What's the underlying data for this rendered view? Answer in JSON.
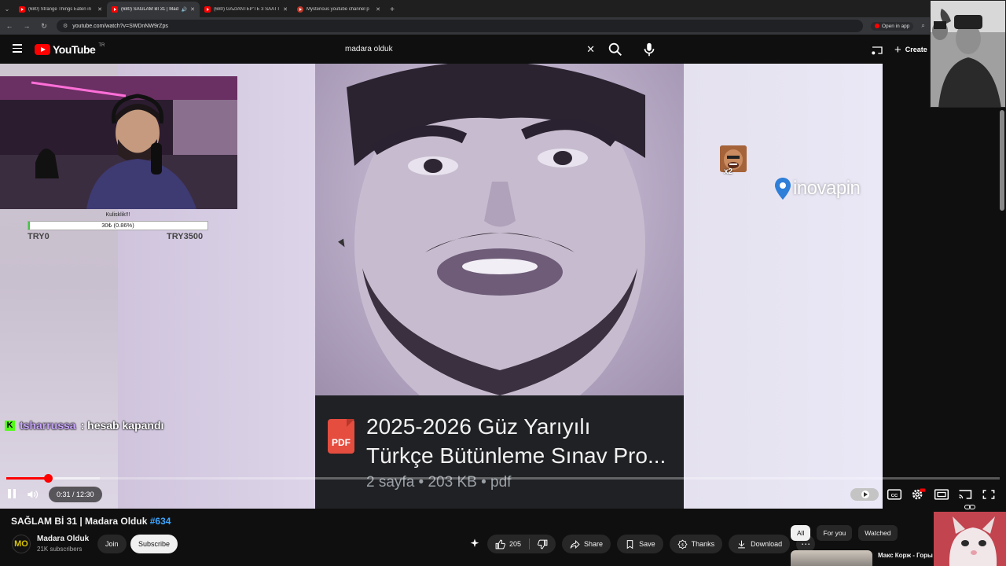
{
  "browser": {
    "tabs": [
      {
        "title": "(680) Strange Things Eaten in"
      },
      {
        "title": "(680) SAĞLAM Bİ 31 | Mada",
        "active": true
      },
      {
        "title": "(680) GAZİANTEP'TE 3 SAATT"
      },
      {
        "title": "Mysterious youtube channel p"
      }
    ],
    "url": "youtube.com/watch?v=SWDnNW9rZps",
    "open_in_app": "Open in app"
  },
  "header": {
    "logo_text": "YouTube",
    "country_code": "TR",
    "search_query": "madara olduk",
    "create_label": "Create"
  },
  "overlay": {
    "goal_label": "Kulisklik!!!",
    "goal_text": "30₺ (0.86%)",
    "goal_progress_pct": 0.86,
    "goal_min": "TRY0",
    "goal_max": "TRY3500",
    "chat_user": "tsharrussa",
    "chat_message": ": hesab kapandı",
    "emote_count": "x2",
    "sponsor": "inovapin",
    "watermark": "MO"
  },
  "pdf_card": {
    "title_line1": "2025-2026 Güz Yarıyılı",
    "title_line2": "Türkçe Bütünleme Sınav Pro...",
    "meta": "2 sayfa • 203 KB • pdf",
    "icon_label": "PDF"
  },
  "player": {
    "time": "0:31 / 12:30",
    "played_fraction": 0.042,
    "buffered_fraction": 0.094
  },
  "video": {
    "title": "SAĞLAM Bİ 31 | Madara Olduk",
    "hashtag": "#634",
    "channel_name": "Madara Olduk",
    "channel_initials": "MO",
    "subscribers": "21K subscribers",
    "join_label": "Join",
    "subscribe_label": "Subscribe",
    "likes": "205",
    "share_label": "Share",
    "save_label": "Save",
    "thanks_label": "Thanks",
    "download_label": "Download"
  },
  "sidebar": {
    "chips": [
      "All",
      "For you",
      "Watched"
    ],
    "rec_title": "Макс Корж - Горы (Official video)"
  },
  "colors": {
    "accent": "#ff0000",
    "link": "#3ea6ff",
    "background": "#0f0f0f"
  }
}
